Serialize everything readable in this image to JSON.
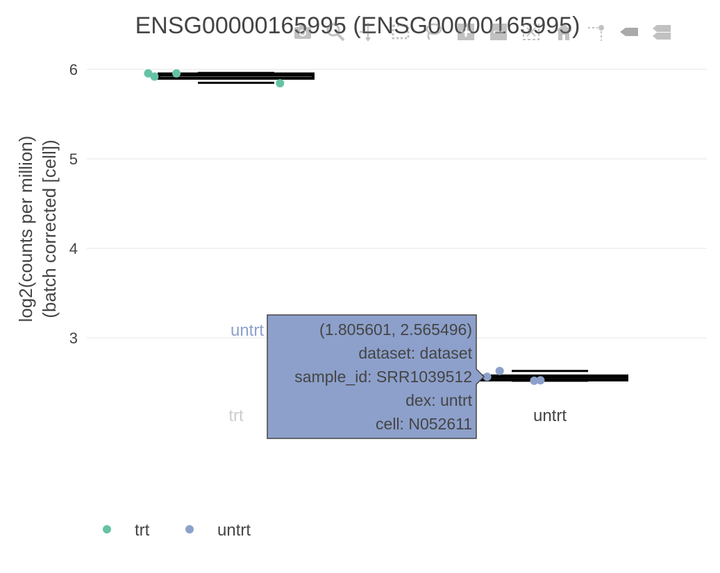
{
  "chart_data": {
    "type": "box",
    "title": "ENSG00000165995 (ENSG00000165995)",
    "ylabel_line1": "log2(counts per million)",
    "ylabel_line2": "(batch corrected [cell])",
    "ylim": [
      1.0,
      6.2
    ],
    "yticks": [
      "3",
      "4",
      "5",
      "6"
    ],
    "ytick_values": [
      3,
      4,
      5,
      6
    ],
    "grid": true,
    "legend_position": "bottom-left",
    "categories": [
      "trt",
      "untrt"
    ],
    "series": [
      {
        "name": "trt",
        "color": "#66c2a5",
        "category": "trt",
        "box": {
          "q1": 5.9,
          "median": 5.93,
          "q3": 5.95,
          "lower": 5.85,
          "upper": 5.96
        },
        "points": [
          {
            "x": 0.72,
            "y": 5.955
          },
          {
            "x": 0.74,
            "y": 5.92
          },
          {
            "x": 0.81,
            "y": 5.955
          },
          {
            "x": 1.14,
            "y": 5.845
          }
        ]
      },
      {
        "name": "untrt",
        "color": "#8da0cb",
        "category": "untrt",
        "box": {
          "q1": 2.53,
          "median": 2.555,
          "q3": 2.575,
          "lower": 2.52,
          "upper": 2.63
        },
        "points": [
          {
            "x": 1.8,
            "y": 2.565
          },
          {
            "x": 1.84,
            "y": 2.63
          },
          {
            "x": 1.95,
            "y": 2.52
          },
          {
            "x": 1.97,
            "y": 2.525
          }
        ]
      }
    ]
  },
  "legend": {
    "items": [
      {
        "label": "trt",
        "color": "#66c2a5"
      },
      {
        "label": "untrt",
        "color": "#8da0cb"
      }
    ]
  },
  "category_labels": {
    "untrt_faint": "untrt",
    "trt_faint": "trt",
    "untrt": "untrt"
  },
  "hover": {
    "bg_color": "#8da0cb",
    "lines": [
      "(1.805601, 2.565496)",
      "dataset: dataset",
      "sample_id: SRR1039512",
      "dex: untrt",
      "cell: N052611"
    ]
  },
  "modebar": {
    "icons": [
      "camera-icon",
      "zoom-icon",
      "pan-icon",
      "box-select-icon",
      "lasso-icon",
      "zoom-in-icon",
      "zoom-out-icon",
      "autoscale-icon",
      "reset-axes-icon",
      "spike-lines-icon",
      "hover-closest-icon",
      "hover-compare-icon"
    ]
  }
}
